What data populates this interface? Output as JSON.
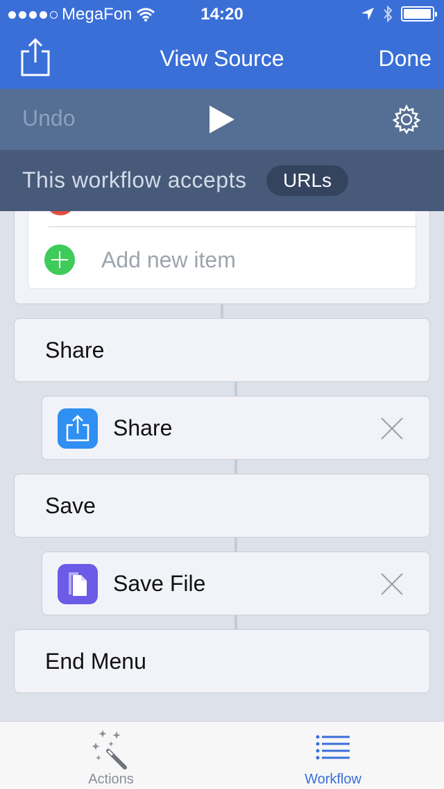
{
  "status": {
    "carrier": "MegaFon",
    "time": "14:20"
  },
  "nav": {
    "title": "View Source",
    "done_label": "Done"
  },
  "toolbar": {
    "undo_label": "Undo"
  },
  "accepts": {
    "text": "This workflow accepts",
    "type": "URLs"
  },
  "list": {
    "add_item_label": "Add new item"
  },
  "rows": [
    {
      "title": "Share",
      "action": "Share",
      "icon": "share-icon",
      "color": "#2f8ff2"
    },
    {
      "title": "Save",
      "action": "Save File",
      "icon": "file-icon",
      "color": "#6b5be6"
    }
  ],
  "end_label": "End Menu",
  "tabs": [
    {
      "label": "Actions",
      "icon": "magic-wand-icon",
      "active": false
    },
    {
      "label": "Workflow",
      "icon": "list-icon",
      "active": true
    }
  ],
  "colors": {
    "accent": "#3a6fd8",
    "toolbar": "#556e93",
    "accepts_bar": "#475a7a",
    "tab_active": "#3a6fd8",
    "tab_inactive": "#8a8e96"
  }
}
